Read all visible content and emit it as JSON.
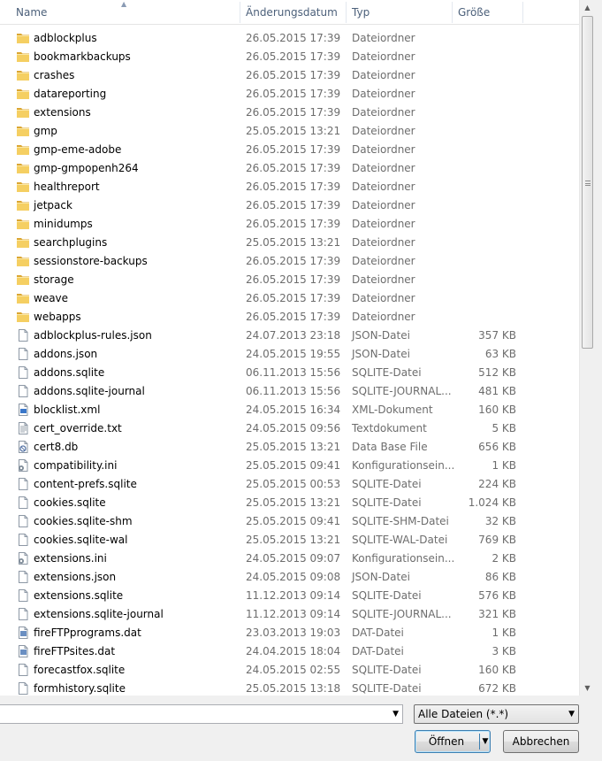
{
  "columns": {
    "name": "Name",
    "date": "Änderungsdatum",
    "type": "Typ",
    "size": "Größe"
  },
  "files": [
    {
      "name": "adblockplus",
      "date": "26.05.2015 17:39",
      "type": "Dateiordner",
      "size": "",
      "icon": "folder-icon"
    },
    {
      "name": "bookmarkbackups",
      "date": "26.05.2015 17:39",
      "type": "Dateiordner",
      "size": "",
      "icon": "folder-icon"
    },
    {
      "name": "crashes",
      "date": "26.05.2015 17:39",
      "type": "Dateiordner",
      "size": "",
      "icon": "folder-icon"
    },
    {
      "name": "datareporting",
      "date": "26.05.2015 17:39",
      "type": "Dateiordner",
      "size": "",
      "icon": "folder-icon"
    },
    {
      "name": "extensions",
      "date": "26.05.2015 17:39",
      "type": "Dateiordner",
      "size": "",
      "icon": "folder-icon"
    },
    {
      "name": "gmp",
      "date": "25.05.2015 13:21",
      "type": "Dateiordner",
      "size": "",
      "icon": "folder-icon"
    },
    {
      "name": "gmp-eme-adobe",
      "date": "26.05.2015 17:39",
      "type": "Dateiordner",
      "size": "",
      "icon": "folder-icon"
    },
    {
      "name": "gmp-gmpopenh264",
      "date": "26.05.2015 17:39",
      "type": "Dateiordner",
      "size": "",
      "icon": "folder-icon"
    },
    {
      "name": "healthreport",
      "date": "26.05.2015 17:39",
      "type": "Dateiordner",
      "size": "",
      "icon": "folder-icon"
    },
    {
      "name": "jetpack",
      "date": "26.05.2015 17:39",
      "type": "Dateiordner",
      "size": "",
      "icon": "folder-icon"
    },
    {
      "name": "minidumps",
      "date": "26.05.2015 17:39",
      "type": "Dateiordner",
      "size": "",
      "icon": "folder-icon"
    },
    {
      "name": "searchplugins",
      "date": "25.05.2015 13:21",
      "type": "Dateiordner",
      "size": "",
      "icon": "folder-icon"
    },
    {
      "name": "sessionstore-backups",
      "date": "26.05.2015 17:39",
      "type": "Dateiordner",
      "size": "",
      "icon": "folder-icon"
    },
    {
      "name": "storage",
      "date": "26.05.2015 17:39",
      "type": "Dateiordner",
      "size": "",
      "icon": "folder-icon"
    },
    {
      "name": "weave",
      "date": "26.05.2015 17:39",
      "type": "Dateiordner",
      "size": "",
      "icon": "folder-icon"
    },
    {
      "name": "webapps",
      "date": "26.05.2015 17:39",
      "type": "Dateiordner",
      "size": "",
      "icon": "folder-icon"
    },
    {
      "name": "adblockplus-rules.json",
      "date": "24.07.2013 23:18",
      "type": "JSON-Datei",
      "size": "357 KB",
      "icon": "file-icon"
    },
    {
      "name": "addons.json",
      "date": "24.05.2015 19:55",
      "type": "JSON-Datei",
      "size": "63 KB",
      "icon": "file-icon"
    },
    {
      "name": "addons.sqlite",
      "date": "06.11.2013 15:56",
      "type": "SQLITE-Datei",
      "size": "512 KB",
      "icon": "file-icon"
    },
    {
      "name": "addons.sqlite-journal",
      "date": "06.11.2013 15:56",
      "type": "SQLITE-JOURNAL...",
      "size": "481 KB",
      "icon": "file-icon"
    },
    {
      "name": "blocklist.xml",
      "date": "24.05.2015 16:34",
      "type": "XML-Dokument",
      "size": "160 KB",
      "icon": "xml-file-icon"
    },
    {
      "name": "cert_override.txt",
      "date": "24.05.2015 09:56",
      "type": "Textdokument",
      "size": "5 KB",
      "icon": "text-file-icon"
    },
    {
      "name": "cert8.db",
      "date": "25.05.2015 13:21",
      "type": "Data Base File",
      "size": "656 KB",
      "icon": "db-file-icon"
    },
    {
      "name": "compatibility.ini",
      "date": "25.05.2015 09:41",
      "type": "Konfigurationsein...",
      "size": "1 KB",
      "icon": "settings-file-icon"
    },
    {
      "name": "content-prefs.sqlite",
      "date": "25.05.2015 00:53",
      "type": "SQLITE-Datei",
      "size": "224 KB",
      "icon": "file-icon"
    },
    {
      "name": "cookies.sqlite",
      "date": "25.05.2015 13:21",
      "type": "SQLITE-Datei",
      "size": "1.024 KB",
      "icon": "file-icon"
    },
    {
      "name": "cookies.sqlite-shm",
      "date": "25.05.2015 09:41",
      "type": "SQLITE-SHM-Datei",
      "size": "32 KB",
      "icon": "file-icon"
    },
    {
      "name": "cookies.sqlite-wal",
      "date": "25.05.2015 13:21",
      "type": "SQLITE-WAL-Datei",
      "size": "769 KB",
      "icon": "file-icon"
    },
    {
      "name": "extensions.ini",
      "date": "24.05.2015 09:07",
      "type": "Konfigurationsein...",
      "size": "2 KB",
      "icon": "settings-file-icon"
    },
    {
      "name": "extensions.json",
      "date": "24.05.2015 09:08",
      "type": "JSON-Datei",
      "size": "86 KB",
      "icon": "file-icon"
    },
    {
      "name": "extensions.sqlite",
      "date": "11.12.2013 09:14",
      "type": "SQLITE-Datei",
      "size": "576 KB",
      "icon": "file-icon"
    },
    {
      "name": "extensions.sqlite-journal",
      "date": "11.12.2013 09:14",
      "type": "SQLITE-JOURNAL...",
      "size": "321 KB",
      "icon": "file-icon"
    },
    {
      "name": "fireFTPprograms.dat",
      "date": "23.03.2013 19:03",
      "type": "DAT-Datei",
      "size": "1 KB",
      "icon": "dat-file-icon"
    },
    {
      "name": "fireFTPsites.dat",
      "date": "24.04.2015 18:04",
      "type": "DAT-Datei",
      "size": "3 KB",
      "icon": "dat-file-icon"
    },
    {
      "name": "forecastfox.sqlite",
      "date": "24.05.2015 02:55",
      "type": "SQLITE-Datei",
      "size": "160 KB",
      "icon": "file-icon"
    },
    {
      "name": "formhistory.sqlite",
      "date": "25.05.2015 13:18",
      "type": "SQLITE-Datei",
      "size": "672 KB",
      "icon": "file-icon"
    }
  ],
  "filename_input": {
    "value": ""
  },
  "filter": {
    "selected": "Alle Dateien (*.*)"
  },
  "buttons": {
    "open": "Öffnen",
    "cancel": "Abbrechen"
  },
  "colors": {
    "folder": "#f5cf62",
    "folder_dark": "#dba632",
    "header_text": "#4c607a"
  }
}
